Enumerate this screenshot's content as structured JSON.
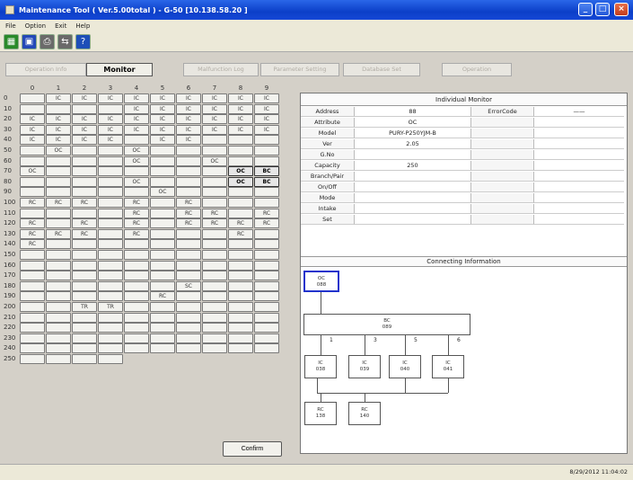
{
  "window": {
    "title": "Maintenance Tool ( Ver.5.00total ) - G-50 [10.138.58.20 ]"
  },
  "menu": [
    "File",
    "Option",
    "Exit",
    "Help"
  ],
  "toolbar": [
    {
      "icon": "grid-icon",
      "color": "#2a8a2a"
    },
    {
      "icon": "save-icon",
      "color": "#2448b8"
    },
    {
      "icon": "print-icon",
      "color": "#6a6a6a"
    },
    {
      "icon": "connect-icon",
      "color": "#6a6a6a"
    },
    {
      "icon": "help-icon",
      "color": "#1e4fb8"
    }
  ],
  "tabs": [
    {
      "label": "Operation Info",
      "active": false
    },
    {
      "label": "Monitor",
      "active": true
    },
    {
      "label": "Malfunction Log",
      "active": false
    },
    {
      "label": "Parameter Setting",
      "active": false
    },
    {
      "label": "Database Set",
      "active": false
    },
    {
      "label": "Operation",
      "active": false
    }
  ],
  "grid": {
    "columns": [
      "0",
      "1",
      "2",
      "3",
      "4",
      "5",
      "6",
      "7",
      "8",
      "9"
    ],
    "rows": [
      {
        "label": "0",
        "cells": [
          "",
          "IC",
          "IC",
          "IC",
          "IC",
          "IC",
          "IC",
          "IC",
          "IC",
          "IC"
        ]
      },
      {
        "label": "10",
        "cells": [
          "",
          "",
          "",
          "",
          "IC",
          "IC",
          "IC",
          "IC",
          "IC",
          "IC"
        ]
      },
      {
        "label": "20",
        "cells": [
          "IC",
          "IC",
          "IC",
          "IC",
          "IC",
          "IC",
          "IC",
          "IC",
          "IC",
          "IC"
        ]
      },
      {
        "label": "30",
        "cells": [
          "IC",
          "IC",
          "IC",
          "IC",
          "IC",
          "IC",
          "IC",
          "IC",
          "IC",
          "IC"
        ]
      },
      {
        "label": "40",
        "cells": [
          "IC",
          "IC",
          "IC",
          "IC",
          "",
          "IC",
          "IC",
          "",
          "",
          ""
        ]
      },
      {
        "label": "50",
        "cells": [
          "",
          "OC",
          "",
          "",
          "OC",
          "",
          "",
          "",
          "",
          ""
        ]
      },
      {
        "label": "60",
        "cells": [
          "",
          "",
          "",
          "",
          "OC",
          "",
          "",
          "OC",
          "",
          ""
        ]
      },
      {
        "label": "70",
        "cells": [
          "OC",
          "",
          "",
          "",
          "",
          "",
          "",
          "",
          "OC",
          "BC"
        ]
      },
      {
        "label": "80",
        "cells": [
          "",
          "",
          "",
          "",
          "OC",
          "",
          "",
          "",
          "OC",
          "BC"
        ]
      },
      {
        "label": "90",
        "cells": [
          "",
          "",
          "",
          "",
          "",
          "OC",
          "",
          "",
          "",
          ""
        ]
      },
      {
        "label": "100",
        "cells": [
          "RC",
          "RC",
          "RC",
          "",
          "RC",
          "",
          "RC",
          "",
          "",
          ""
        ]
      },
      {
        "label": "110",
        "cells": [
          "",
          "",
          "",
          "",
          "RC",
          "",
          "RC",
          "RC",
          "",
          "RC"
        ]
      },
      {
        "label": "120",
        "cells": [
          "RC",
          "",
          "RC",
          "",
          "RC",
          "",
          "RC",
          "RC",
          "RC",
          "RC"
        ]
      },
      {
        "label": "130",
        "cells": [
          "RC",
          "RC",
          "RC",
          "",
          "RC",
          "",
          "",
          "",
          "RC",
          ""
        ]
      },
      {
        "label": "140",
        "cells": [
          "RC",
          "",
          "",
          "",
          "",
          "",
          "",
          "",
          "",
          ""
        ]
      },
      {
        "label": "150",
        "cells": [
          "",
          "",
          "",
          "",
          "",
          "",
          "",
          "",
          "",
          ""
        ]
      },
      {
        "label": "160",
        "cells": [
          "",
          "",
          "",
          "",
          "",
          "",
          "",
          "",
          "",
          ""
        ]
      },
      {
        "label": "170",
        "cells": [
          "",
          "",
          "",
          "",
          "",
          "",
          "",
          "",
          "",
          ""
        ]
      },
      {
        "label": "180",
        "cells": [
          "",
          "",
          "",
          "",
          "",
          "",
          "SC",
          "",
          "",
          ""
        ]
      },
      {
        "label": "190",
        "cells": [
          "",
          "",
          "",
          "",
          "",
          "RC",
          "",
          "",
          "",
          ""
        ]
      },
      {
        "label": "200",
        "cells": [
          "",
          "",
          "TR",
          "TR",
          "",
          "",
          "",
          "",
          "",
          ""
        ]
      },
      {
        "label": "210",
        "cells": [
          "",
          "",
          "",
          "",
          "",
          "",
          "",
          "",
          "",
          ""
        ]
      },
      {
        "label": "220",
        "cells": [
          "",
          "",
          "",
          "",
          "",
          "",
          "",
          "",
          "",
          ""
        ]
      },
      {
        "label": "230",
        "cells": [
          "",
          "",
          "",
          "",
          "",
          "",
          "",
          "",
          "",
          ""
        ]
      },
      {
        "label": "240",
        "cells": [
          "",
          "",
          "",
          "",
          "",
          "",
          "",
          "",
          "",
          ""
        ]
      },
      {
        "label": "250",
        "cells": [
          "",
          "",
          "",
          ""
        ]
      }
    ],
    "confirm_label": "Confirm"
  },
  "monitor": {
    "title": "Individual Monitor",
    "rows": [
      {
        "label": "Address",
        "value": "88"
      },
      {
        "label": "Attribute",
        "value": "OC"
      },
      {
        "label": "Model",
        "value": "PURY-P250YJM-B"
      },
      {
        "label": "Ver",
        "value": "2.05"
      },
      {
        "label": "G.No",
        "value": ""
      },
      {
        "label": "Capacity",
        "value": "250"
      },
      {
        "label": "Branch/Pair",
        "value": ""
      },
      {
        "label": "On/Off",
        "value": ""
      },
      {
        "label": "Mode",
        "value": ""
      },
      {
        "label": "Intake",
        "value": ""
      },
      {
        "label": "Set",
        "value": ""
      }
    ],
    "error_label": "ErrorCode",
    "error_value": "——",
    "connecting_title": "Connecting Information",
    "nodes": {
      "oc": {
        "type": "OC",
        "addr": "088"
      },
      "bc": {
        "type": "BC",
        "addr": "089"
      },
      "ics": [
        {
          "type": "IC",
          "addr": "038"
        },
        {
          "type": "IC",
          "addr": "039"
        },
        {
          "type": "IC",
          "addr": "040"
        },
        {
          "type": "IC",
          "addr": "041"
        }
      ],
      "port_labels": [
        "1",
        "3",
        "5",
        "6"
      ],
      "rcs": [
        {
          "type": "RC",
          "addr": "138"
        },
        {
          "type": "RC",
          "addr": "140"
        }
      ]
    }
  },
  "status": {
    "text": "8/29/2012 11:04:02"
  }
}
